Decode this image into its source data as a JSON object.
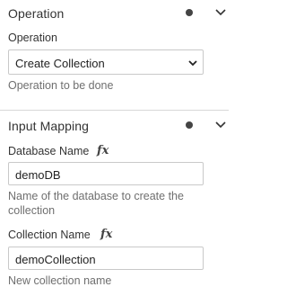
{
  "operation_section": {
    "title": "Operation",
    "field_label": "Operation",
    "selected_value": "Create Collection",
    "help": "Operation to be done"
  },
  "input_mapping_section": {
    "title": "Input Mapping",
    "fx_icon": "fx",
    "database_name": {
      "label": "Database Name",
      "value": "demoDB",
      "help": "Name of the database to create the collection"
    },
    "collection_name": {
      "label": "Collection Name",
      "value": "demoCollection",
      "help": "New collection name"
    }
  },
  "colors": {
    "dot": "#444444",
    "divider": "#d8d8d8",
    "input_border": "#c9c9c9"
  }
}
